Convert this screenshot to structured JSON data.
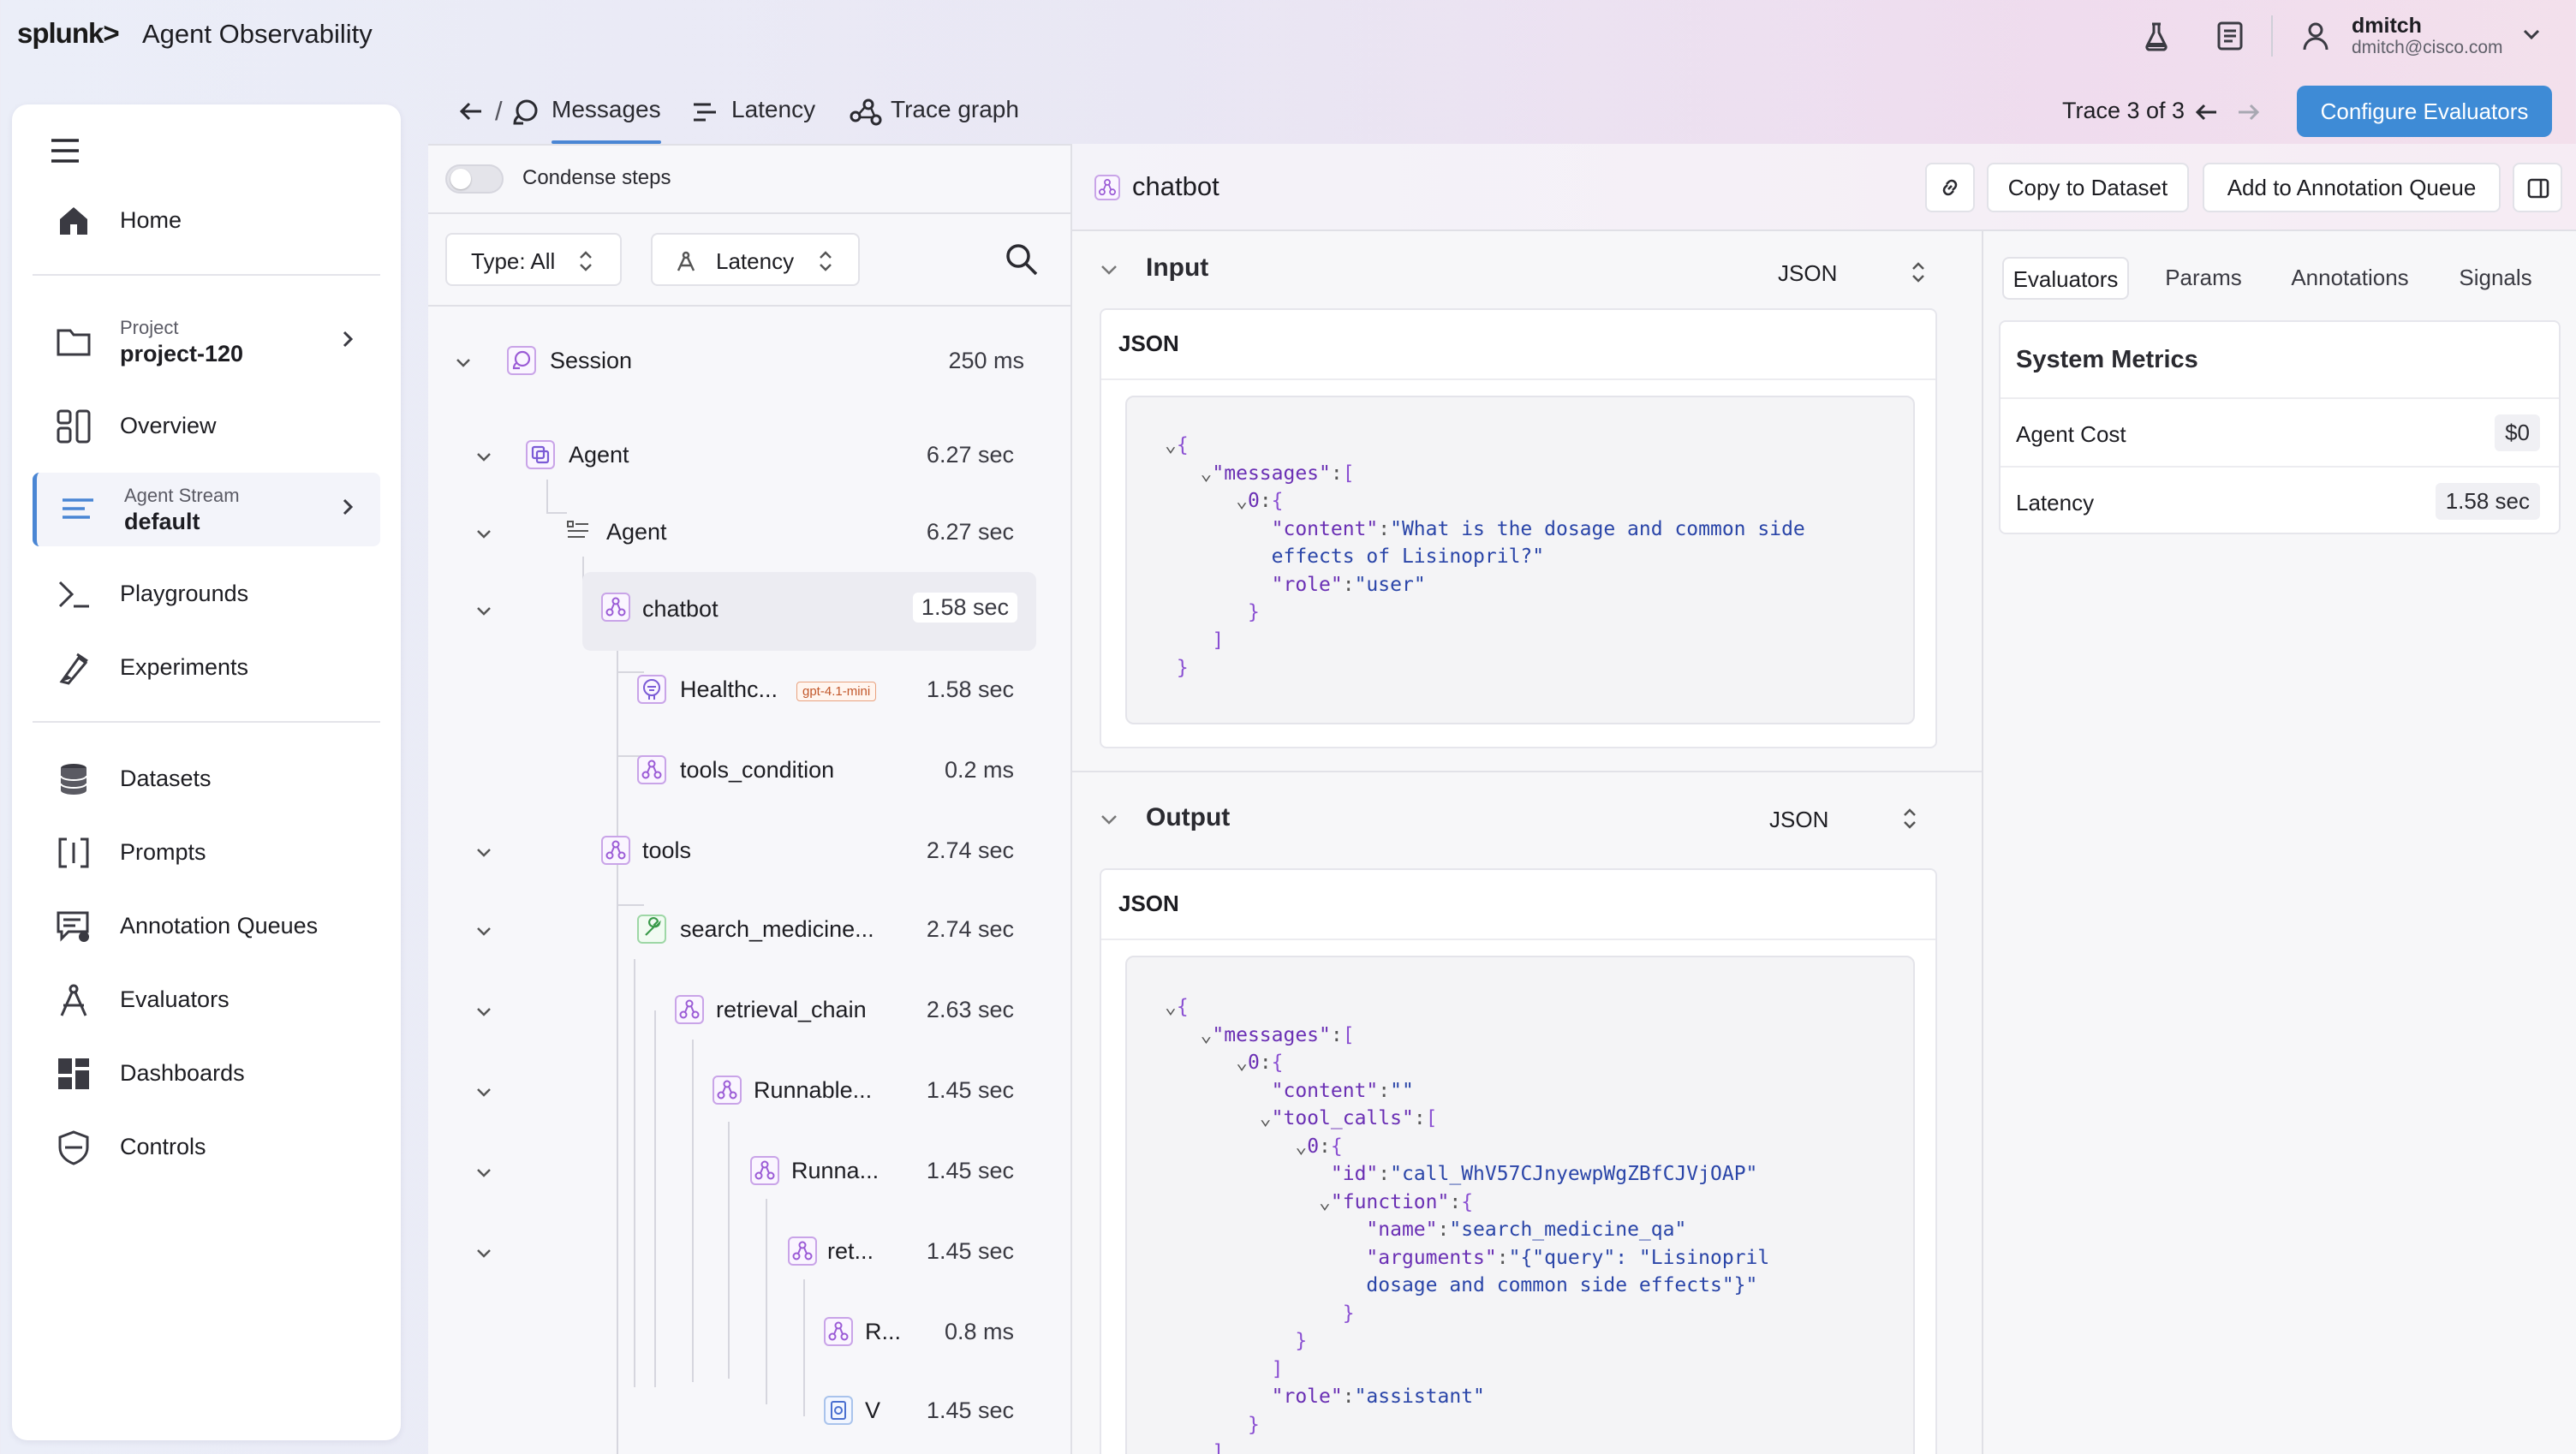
{
  "app": {
    "logo": "splunk>",
    "title": "Agent Observability"
  },
  "user": {
    "name": "dmitch",
    "email": "dmitch@cisco.com"
  },
  "sidebar": {
    "home": "Home",
    "project": {
      "label": "Project",
      "value": "project-120"
    },
    "overview": "Overview",
    "stream": {
      "label": "Agent Stream",
      "value": "default"
    },
    "playgrounds": "Playgrounds",
    "experiments": "Experiments",
    "datasets": "Datasets",
    "prompts": "Prompts",
    "annotation_queues": "Annotation Queues",
    "evaluators": "Evaluators",
    "dashboards": "Dashboards",
    "controls": "Controls"
  },
  "header": {
    "crumb_sep": "/",
    "tabs": {
      "messages": "Messages",
      "latency": "Latency",
      "trace_graph": "Trace graph"
    },
    "trace_position": "Trace 3 of 3",
    "configure_button": "Configure Evaluators"
  },
  "tree": {
    "condense_label": "Condense steps",
    "type_filter": "Type: All",
    "latency_filter": "Latency",
    "rows": [
      {
        "label": "Session",
        "duration": "250 ms"
      },
      {
        "label": "Agent",
        "duration": "6.27 sec"
      },
      {
        "label": "Agent",
        "duration": "6.27 sec"
      },
      {
        "label": "chatbot",
        "duration": "1.58 sec"
      },
      {
        "label": "Healthc...",
        "duration": "1.58 sec",
        "badge": "gpt-4.1-mini"
      },
      {
        "label": "tools_condition",
        "duration": "0.2 ms"
      },
      {
        "label": "tools",
        "duration": "2.74 sec"
      },
      {
        "label": "search_medicine...",
        "duration": "2.74 sec"
      },
      {
        "label": "retrieval_chain",
        "duration": "2.63 sec"
      },
      {
        "label": "Runnable...",
        "duration": "1.45 sec"
      },
      {
        "label": "Runna...",
        "duration": "1.45 sec"
      },
      {
        "label": "ret...",
        "duration": "1.45 sec"
      },
      {
        "label": "R...",
        "duration": "0.8 ms"
      },
      {
        "label": "V",
        "duration": "1.45 sec"
      }
    ]
  },
  "detail": {
    "node_title": "chatbot",
    "copy_button": "Copy to Dataset",
    "annotate_button": "Add to Annotation Queue",
    "input": {
      "title": "Input",
      "format": "JSON",
      "card_label": "JSON"
    },
    "output": {
      "title": "Output",
      "format": "JSON",
      "card_label": "JSON"
    }
  },
  "right": {
    "tabs": {
      "evaluators": "Evaluators",
      "params": "Params",
      "annotations": "Annotations",
      "signals": "Signals"
    },
    "metrics_title": "System Metrics",
    "agent_cost_label": "Agent Cost",
    "agent_cost_value": "$0",
    "latency_label": "Latency",
    "latency_value": "1.58 sec"
  },
  "icons": {
    "flask": "flask-icon",
    "doc": "document-icon",
    "user": "user-icon",
    "home": "home-icon",
    "folder": "folder-icon",
    "overview": "overview-icon",
    "stream": "stream-icon",
    "terminal": "terminal-icon",
    "experiment": "pencil-flask-icon",
    "database": "database-icon",
    "prompt": "brackets-icon",
    "queue": "chat-gear-icon",
    "evaluator": "evaluator-icon",
    "dashboard": "dashboard-icon",
    "shield": "shield-icon"
  },
  "colors": {
    "accent": "#3e8bd6",
    "node_border": "#c9a4e8",
    "json_string": "#2a45a8",
    "json_key": "#6a2fb4"
  }
}
